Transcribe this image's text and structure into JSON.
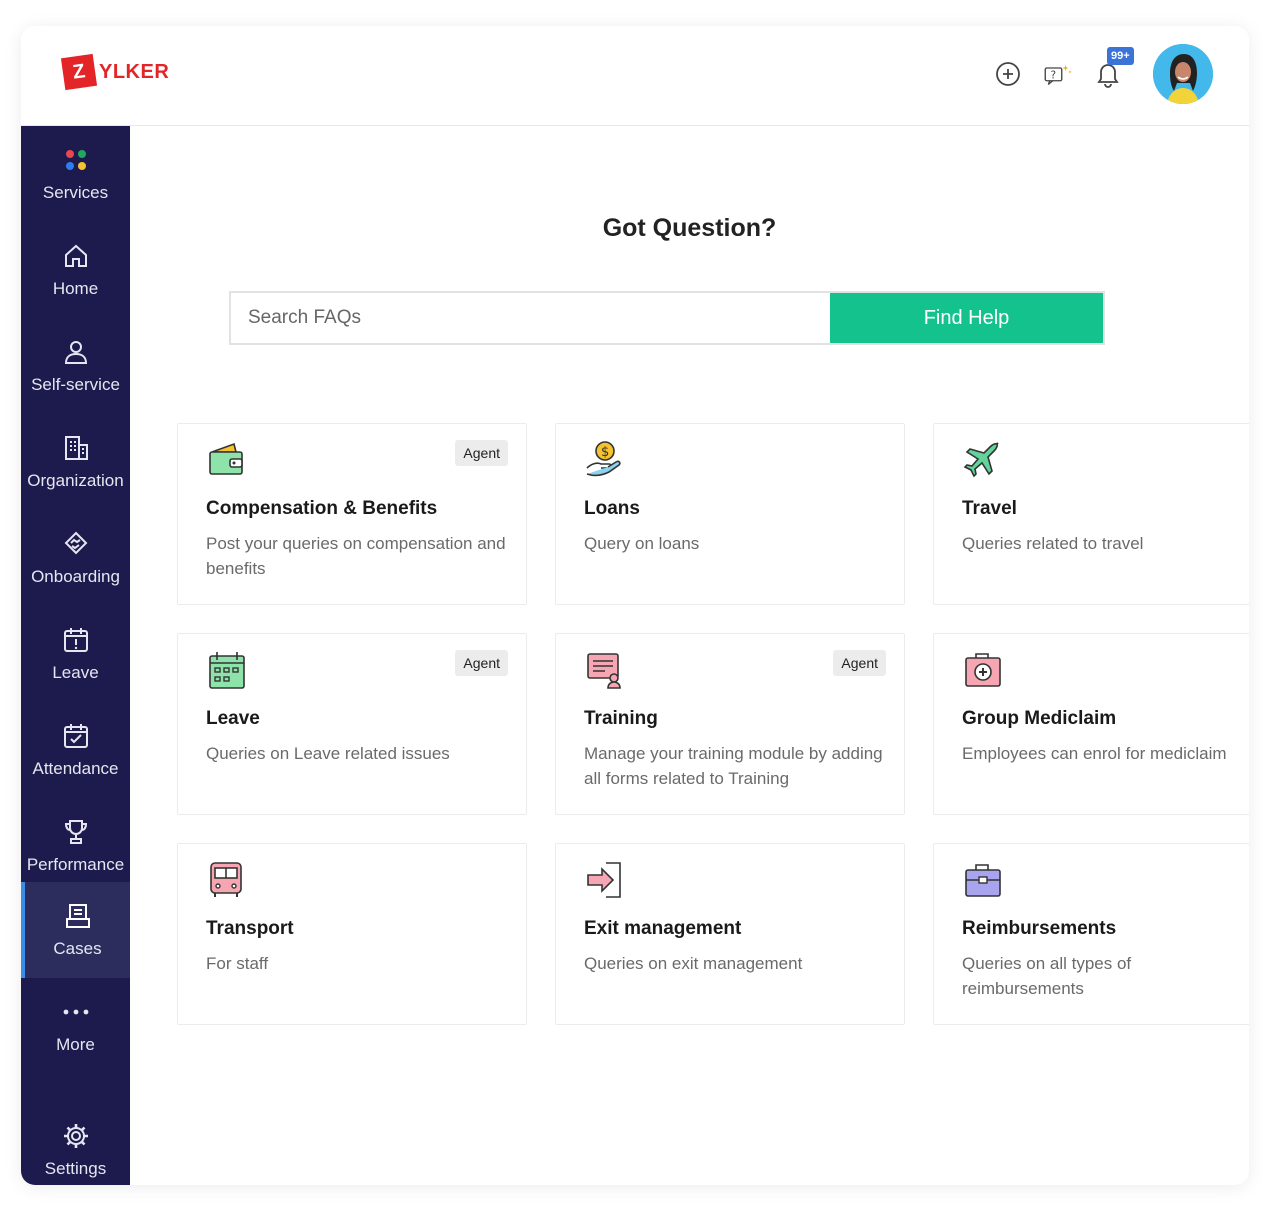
{
  "brand": {
    "logo_letter": "Z",
    "logo_text": "YLKER",
    "color": "#e42527"
  },
  "header": {
    "notification_count": "99+"
  },
  "sidebar": {
    "items": [
      {
        "label": "Services",
        "icon": "services-dots-icon"
      },
      {
        "label": "Home",
        "icon": "home-icon"
      },
      {
        "label": "Self-service",
        "icon": "person-icon"
      },
      {
        "label": "Organization",
        "icon": "building-icon"
      },
      {
        "label": "Onboarding",
        "icon": "handshake-icon"
      },
      {
        "label": "Leave",
        "icon": "calendar-alert-icon"
      },
      {
        "label": "Attendance",
        "icon": "calendar-check-icon"
      },
      {
        "label": "Performance",
        "icon": "trophy-icon"
      },
      {
        "label": "Cases",
        "icon": "cases-icon",
        "active": true
      },
      {
        "label": "More",
        "icon": "more-icon"
      },
      {
        "label": "Settings",
        "icon": "gear-icon"
      }
    ]
  },
  "main": {
    "title": "Got Question?",
    "search": {
      "placeholder": "Search FAQs",
      "button": "Find Help"
    },
    "cards": [
      {
        "title": "Compensation & Benefits",
        "desc": "Post your queries on compensation and benefits",
        "agent": "Agent",
        "icon": "wallet-icon"
      },
      {
        "title": "Loans",
        "desc": "Query on loans",
        "icon": "loan-hand-icon"
      },
      {
        "title": "Travel",
        "desc": "Queries related to travel",
        "icon": "airplane-icon"
      },
      {
        "title": "Leave",
        "desc": "Queries on Leave related issues",
        "agent": "Agent",
        "icon": "calendar-icon"
      },
      {
        "title": "Training",
        "desc": "Manage your training module by adding all forms related to Training",
        "agent": "Agent",
        "icon": "training-icon"
      },
      {
        "title": "Group Mediclaim",
        "desc": "Employees can enrol for mediclaim",
        "icon": "medical-kit-icon"
      },
      {
        "title": "Transport",
        "desc": "For staff",
        "icon": "bus-icon"
      },
      {
        "title": "Exit management",
        "desc": "Queries on exit management",
        "icon": "exit-icon"
      },
      {
        "title": "Reimbursements",
        "desc": "Queries on all types of reimbursements",
        "icon": "briefcase-icon"
      }
    ]
  },
  "colors": {
    "sidebar": "#1d1b4d",
    "accent": "#13c28d",
    "active_border": "#3b8ee8"
  }
}
